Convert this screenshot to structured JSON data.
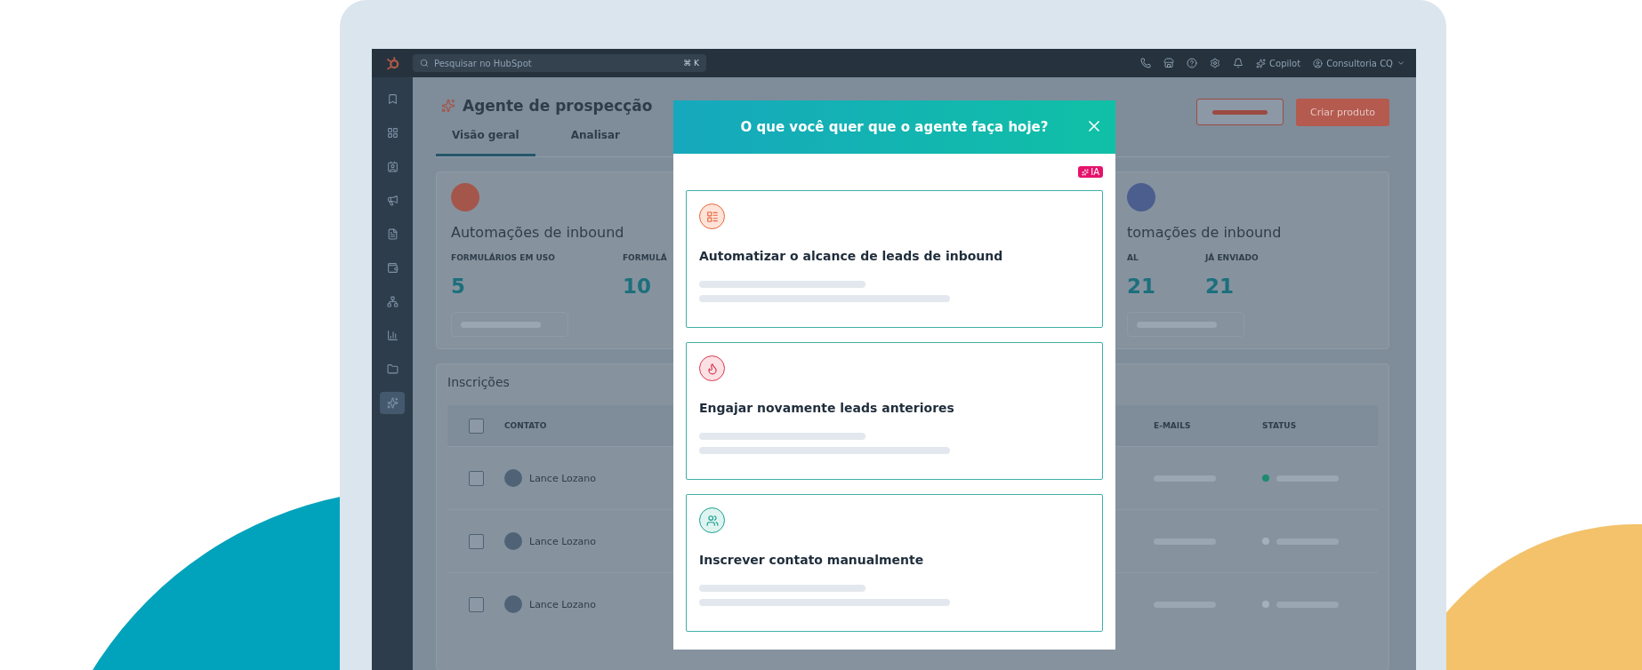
{
  "topbar": {
    "search_placeholder": "Pesquisar no HubSpot",
    "shortcut": "⌘ K",
    "copilot": "Copilot",
    "account": "Consultoria CQ"
  },
  "sidebar": {
    "items": [
      {
        "kind": "bookmark",
        "selected": false
      },
      {
        "kind": "grid",
        "selected": false
      },
      {
        "kind": "contacts",
        "selected": false
      },
      {
        "kind": "megaphone",
        "selected": false
      },
      {
        "kind": "document",
        "selected": false
      },
      {
        "kind": "wallet",
        "selected": false
      },
      {
        "kind": "network",
        "selected": false
      },
      {
        "kind": "chart",
        "selected": false
      },
      {
        "kind": "folder",
        "selected": false
      },
      {
        "kind": "agent",
        "selected": true
      }
    ]
  },
  "page": {
    "title": "Agente de prospecção",
    "tabs": [
      {
        "label": "Visão geral",
        "selected": true
      },
      {
        "label": "Analisar",
        "selected": false
      }
    ],
    "primary_button": "Criar produto"
  },
  "cards": [
    {
      "title": "Automações de inbound",
      "color": "#a4564b",
      "stats": [
        {
          "label": "FORMULÁRIOS EM USO",
          "value": "5"
        },
        {
          "label": "FORMULÁ",
          "value": "10"
        }
      ]
    },
    {
      "title": "tomações de inbound",
      "color": "#4b5e8e",
      "stats": [
        {
          "label": "AL",
          "value": "21"
        },
        {
          "label": "JÁ ENVIADO",
          "value": "21"
        }
      ]
    }
  ],
  "enrollments": {
    "title": "Inscrições",
    "all_checked": false,
    "columns": [
      "CONTATO",
      "E-MAILS",
      "STATUS"
    ],
    "rows": [
      {
        "name": "Lance Lozano",
        "checked": false,
        "color": "#1f8a6e"
      },
      {
        "name": "Lance Lozano",
        "checked": false,
        "color": "#a6b0ba"
      },
      {
        "name": "Lance Lozano",
        "checked": false,
        "color": "#a6b0ba"
      }
    ]
  },
  "modal": {
    "title": "O que você quer que o agente faça hoje?",
    "badge": "IA",
    "options": [
      {
        "kind": "form",
        "label": "Automatizar o alcance de leads de inbound"
      },
      {
        "kind": "fire",
        "label": "Engajar novamente leads anteriores"
      },
      {
        "kind": "people",
        "label": "Inscrever contato manualmente"
      }
    ]
  }
}
